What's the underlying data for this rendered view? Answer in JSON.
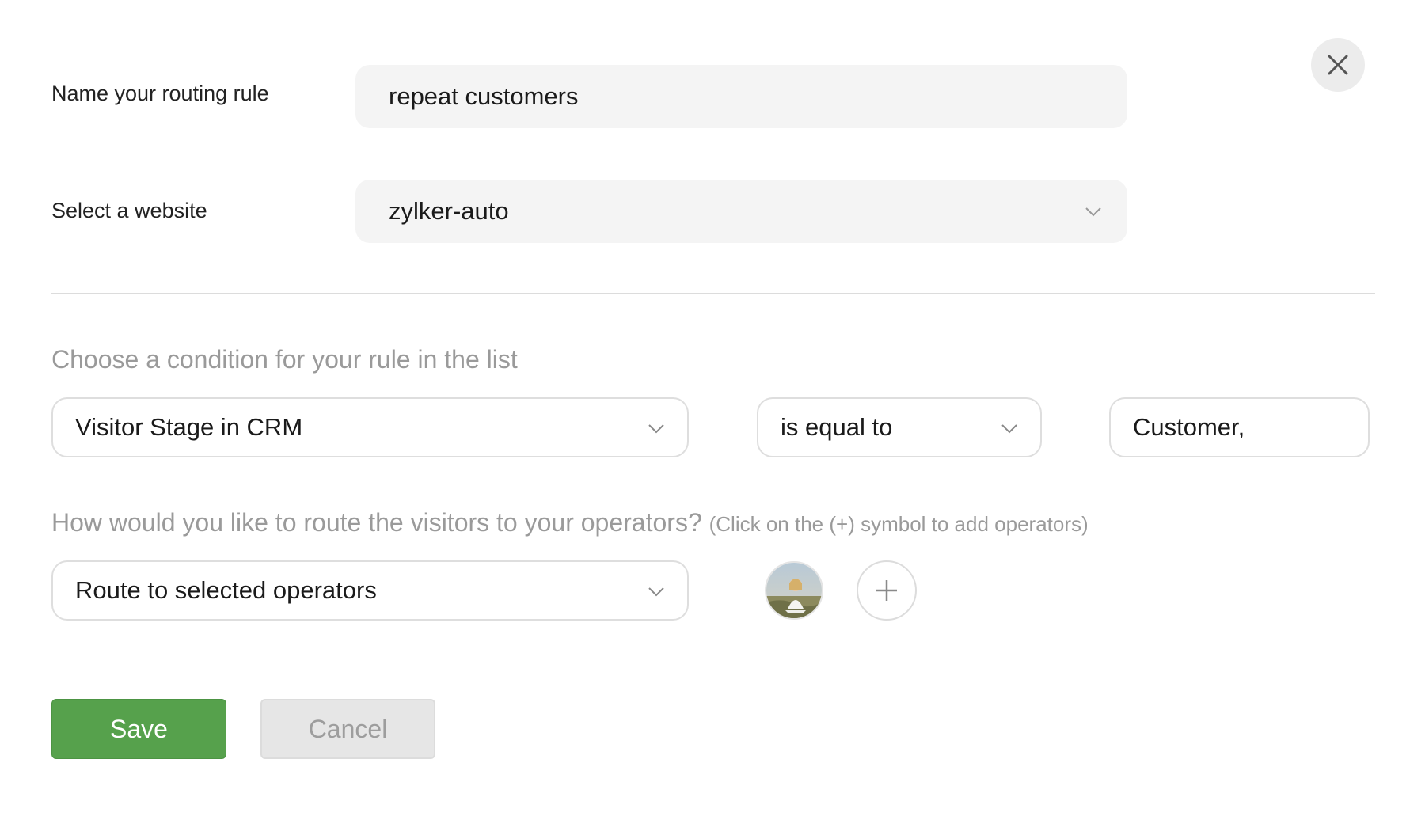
{
  "form": {
    "name_label": "Name your routing rule",
    "name_value": "repeat customers",
    "website_label": "Select a website",
    "website_value": "zylker-auto"
  },
  "condition": {
    "heading": "Choose a condition for your rule in the list",
    "field_value": "Visitor Stage in CRM",
    "operator_value": "is equal to",
    "match_value": "Customer,"
  },
  "routing": {
    "heading": "How would you like to route the visitors to your operators?",
    "heading_hint": "(Click on the (+) symbol to add operators)",
    "method_value": "Route to selected operators"
  },
  "actions": {
    "save_label": "Save",
    "cancel_label": "Cancel"
  },
  "icons": {
    "close": "close-icon",
    "chevron": "chevron-down-icon",
    "add": "plus-icon",
    "avatar": "operator-avatar"
  },
  "colors": {
    "primary": "#56a14c",
    "input_fill": "#f4f4f4",
    "muted_text": "#9a9a9a"
  }
}
